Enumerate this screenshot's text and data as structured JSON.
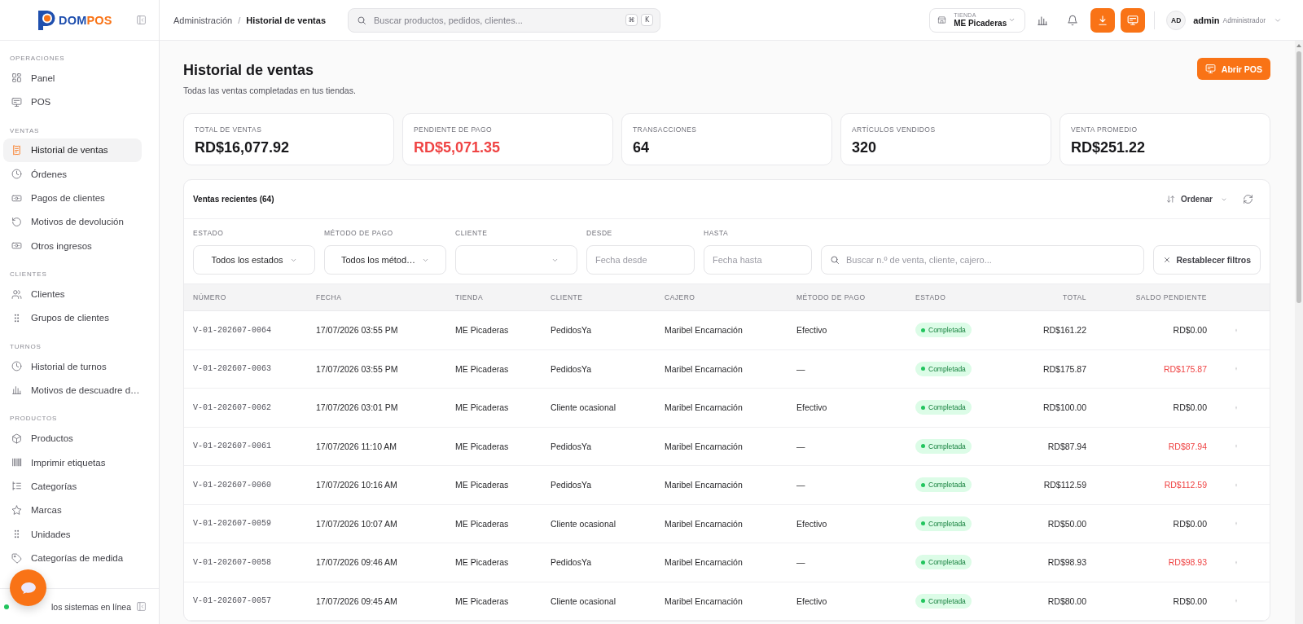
{
  "sidebar": {
    "logo": {
      "primary": "DOM",
      "accent": "POS"
    },
    "sections": [
      {
        "title": "OPERACIONES",
        "items": [
          {
            "label": "Panel",
            "selected": false
          },
          {
            "label": "POS",
            "selected": false
          }
        ]
      },
      {
        "title": "VENTAS",
        "items": [
          {
            "label": "Historial de ventas",
            "selected": true
          },
          {
            "label": "Órdenes",
            "selected": false
          },
          {
            "label": "Pagos de clientes",
            "selected": false
          },
          {
            "label": "Motivos de devolución",
            "selected": false
          },
          {
            "label": "Otros ingresos",
            "selected": false
          }
        ]
      },
      {
        "title": "CLIENTES",
        "items": [
          {
            "label": "Clientes",
            "selected": false
          },
          {
            "label": "Grupos de clientes",
            "selected": false
          }
        ]
      },
      {
        "title": "TURNOS",
        "items": [
          {
            "label": "Historial de turnos",
            "selected": false
          },
          {
            "label": "Motivos de descuadre d…",
            "selected": false
          }
        ]
      },
      {
        "title": "PRODUCTOS",
        "items": [
          {
            "label": "Productos",
            "selected": false
          },
          {
            "label": "Imprimir etiquetas",
            "selected": false
          },
          {
            "label": "Categorías",
            "selected": false
          },
          {
            "label": "Marcas",
            "selected": false
          },
          {
            "label": "Unidades",
            "selected": false
          },
          {
            "label": "Categorías de medida",
            "selected": false
          }
        ]
      }
    ],
    "footer": {
      "status": "los sistemas en línea"
    }
  },
  "header": {
    "breadcrumb": {
      "separator": "/",
      "items": [
        {
          "label": "Administración",
          "current": false
        },
        {
          "label": "Historial de ventas",
          "current": true
        }
      ]
    },
    "search": {
      "placeholder": "Buscar productos, pedidos, clientes...",
      "shortcut": [
        "⌘",
        "K"
      ]
    },
    "store": {
      "label": "TIENDA",
      "value": "ME Picaderas"
    },
    "user": {
      "initials": "AD",
      "name": "admin",
      "role": "Administrador"
    }
  },
  "page": {
    "title": "Historial de ventas",
    "subtitle": "Todas las ventas completadas en tus tiendas.",
    "action": "Abrir POS"
  },
  "stats": [
    {
      "label": "TOTAL DE VENTAS",
      "value": "RD$16,077.92",
      "alert": false
    },
    {
      "label": "PENDIENTE DE PAGO",
      "value": "RD$5,071.35",
      "alert": true
    },
    {
      "label": "TRANSACCIONES",
      "value": "64",
      "alert": false
    },
    {
      "label": "ARTÍCULOS VENDIDOS",
      "value": "320",
      "alert": false
    },
    {
      "label": "VENTA PROMEDIO",
      "value": "RD$251.22",
      "alert": false
    }
  ],
  "sales": {
    "title": "Ventas recientes (64)",
    "sort": "Ordenar",
    "filters": [
      {
        "kind": "select",
        "label": "ESTADO",
        "value": "Todos los estados"
      },
      {
        "kind": "select",
        "label": "MÉTODO DE PAGO",
        "value": "Todos los métod…"
      },
      {
        "kind": "select",
        "label": "CLIENTE"
      },
      {
        "kind": "date",
        "label": "DESDE",
        "placeholder": "Fecha desde"
      },
      {
        "kind": "date",
        "label": "HASTA",
        "placeholder": "Fecha hasta"
      },
      {
        "kind": "search",
        "placeholder": "Buscar n.º de venta, cliente, cajero..."
      }
    ],
    "reset": "Restablecer filtros",
    "table": {
      "columns": [
        "NÚMERO",
        "FECHA",
        "TIENDA",
        "CLIENTE",
        "CAJERO",
        "MÉTODO DE PAGO",
        "ESTADO",
        "TOTAL",
        "SALDO PENDIENTE"
      ],
      "rows": [
        {
          "number": "V-01-202607-0064",
          "date": "17/07/2026 03:55 PM",
          "store": "ME Picaderas",
          "client": "PedidosYa",
          "cashier": "Maribel Encarnación",
          "method": "Efectivo",
          "status": "Completada",
          "total": "RD$161.22",
          "balance": "RD$0.00",
          "pending": false
        },
        {
          "number": "V-01-202607-0063",
          "date": "17/07/2026 03:55 PM",
          "store": "ME Picaderas",
          "client": "PedidosYa",
          "cashier": "Maribel Encarnación",
          "method": "—",
          "status": "Completada",
          "total": "RD$175.87",
          "balance": "RD$175.87",
          "pending": true
        },
        {
          "number": "V-01-202607-0062",
          "date": "17/07/2026 03:01 PM",
          "store": "ME Picaderas",
          "client": "Cliente ocasional",
          "cashier": "Maribel Encarnación",
          "method": "Efectivo",
          "status": "Completada",
          "total": "RD$100.00",
          "balance": "RD$0.00",
          "pending": false
        },
        {
          "number": "V-01-202607-0061",
          "date": "17/07/2026 11:10 AM",
          "store": "ME Picaderas",
          "client": "PedidosYa",
          "cashier": "Maribel Encarnación",
          "method": "—",
          "status": "Completada",
          "total": "RD$87.94",
          "balance": "RD$87.94",
          "pending": true
        },
        {
          "number": "V-01-202607-0060",
          "date": "17/07/2026 10:16 AM",
          "store": "ME Picaderas",
          "client": "PedidosYa",
          "cashier": "Maribel Encarnación",
          "method": "—",
          "status": "Completada",
          "total": "RD$112.59",
          "balance": "RD$112.59",
          "pending": true
        },
        {
          "number": "V-01-202607-0059",
          "date": "17/07/2026 10:07 AM",
          "store": "ME Picaderas",
          "client": "Cliente ocasional",
          "cashier": "Maribel Encarnación",
          "method": "Efectivo",
          "status": "Completada",
          "total": "RD$50.00",
          "balance": "RD$0.00",
          "pending": false
        },
        {
          "number": "V-01-202607-0058",
          "date": "17/07/2026 09:46 AM",
          "store": "ME Picaderas",
          "client": "PedidosYa",
          "cashier": "Maribel Encarnación",
          "method": "—",
          "status": "Completada",
          "total": "RD$98.93",
          "balance": "RD$98.93",
          "pending": true
        },
        {
          "number": "V-01-202607-0057",
          "date": "17/07/2026 09:45 AM",
          "store": "ME Picaderas",
          "client": "Cliente ocasional",
          "cashier": "Maribel Encarnación",
          "method": "Efectivo",
          "status": "Completada",
          "total": "RD$80.00",
          "balance": "RD$0.00",
          "pending": false
        }
      ]
    }
  }
}
